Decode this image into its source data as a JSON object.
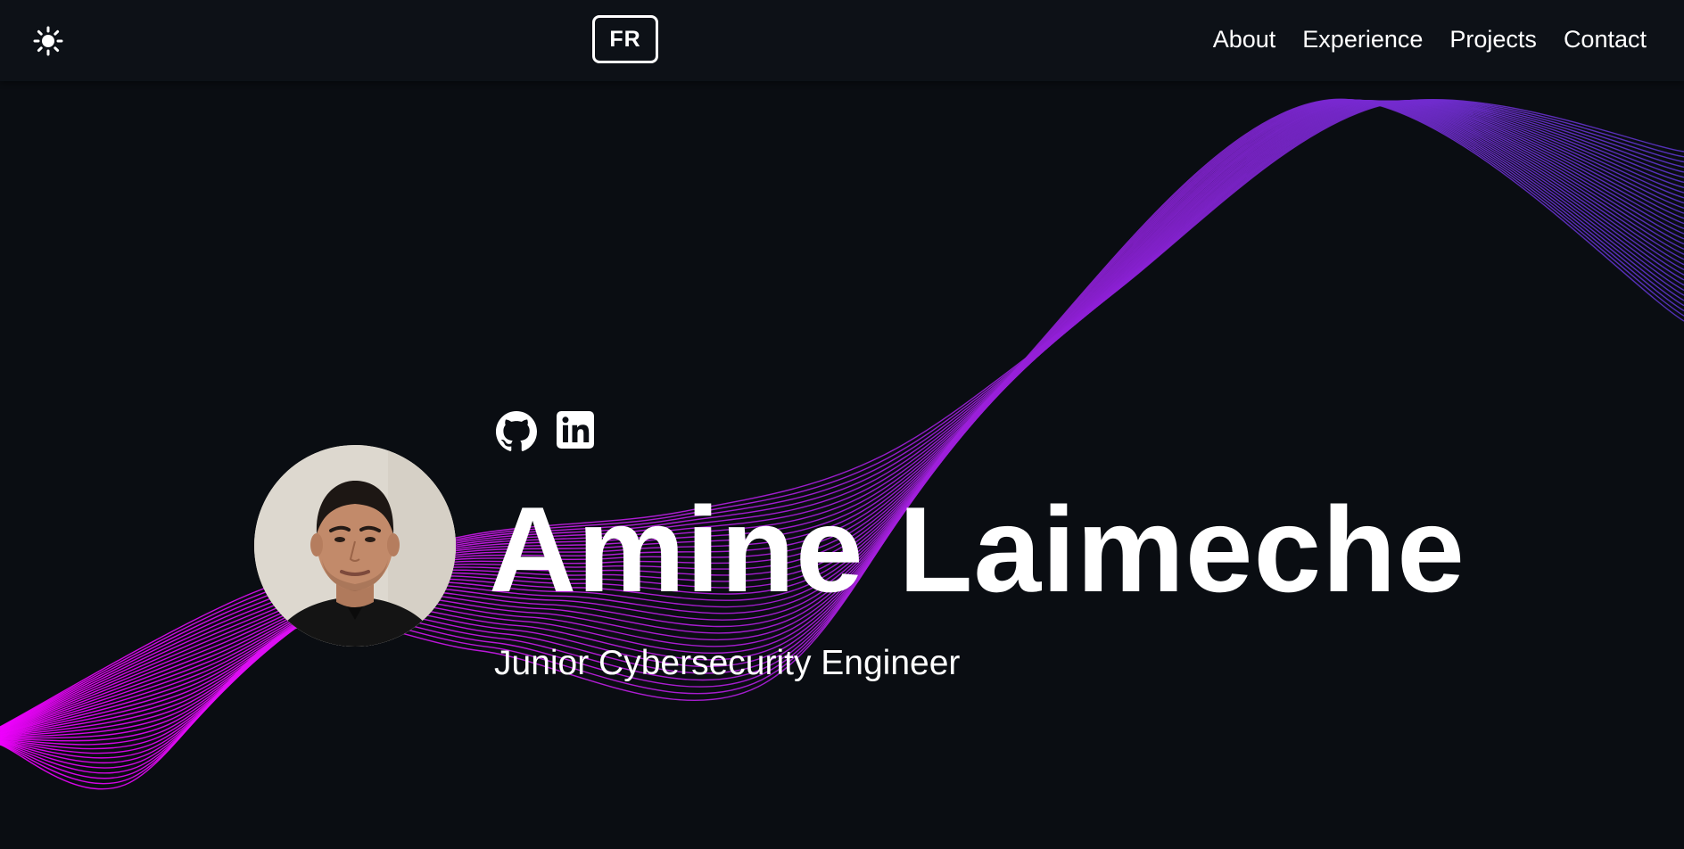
{
  "header": {
    "theme_toggle_icon": "sun-icon",
    "language_button": "FR",
    "nav": [
      {
        "label": "About"
      },
      {
        "label": "Experience"
      },
      {
        "label": "Projects"
      },
      {
        "label": "Contact"
      }
    ]
  },
  "hero": {
    "name": "Amine Laimeche",
    "title": "Junior Cybersecurity Engineer",
    "avatar_icon": "profile-photo",
    "socials": [
      {
        "icon": "github-icon"
      },
      {
        "icon": "linkedin-icon"
      }
    ]
  },
  "colors": {
    "background": "#0a0d12",
    "header_background": "#0d1117",
    "accent_magenta": "#e600ff",
    "accent_violet": "#7a2ad8",
    "accent_indigo": "#5a35c8",
    "text": "#ffffff"
  }
}
